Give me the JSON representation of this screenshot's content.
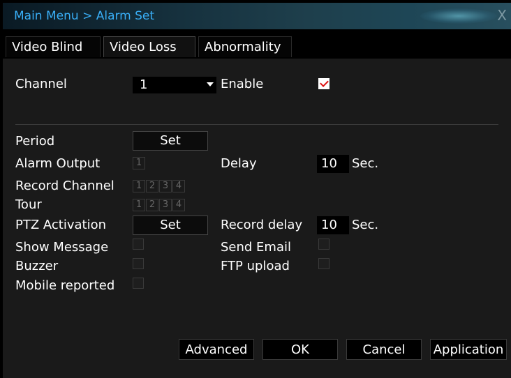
{
  "window": {
    "title": "Main Menu > Alarm Set",
    "close_label": "X"
  },
  "tabs": [
    {
      "label": "Video Blind"
    },
    {
      "label": "Video Loss"
    },
    {
      "label": "Abnormality"
    }
  ],
  "form": {
    "channel_label": "Channel",
    "channel_value": "1",
    "enable_label": "Enable",
    "enable_checked": true,
    "period_label": "Period",
    "period_button": "Set",
    "alarm_output_label": "Alarm Output",
    "alarm_output_boxes": [
      "1"
    ],
    "delay_label": "Delay",
    "delay_value": "10",
    "delay_unit": "Sec.",
    "record_channel_label": "Record Channel",
    "record_channel_boxes": [
      "1",
      "2",
      "3",
      "4"
    ],
    "tour_label": "Tour",
    "tour_boxes": [
      "1",
      "2",
      "3",
      "4"
    ],
    "ptz_label": "PTZ Activation",
    "ptz_button": "Set",
    "record_delay_label": "Record delay",
    "record_delay_value": "10",
    "record_delay_unit": "Sec.",
    "show_message_label": "Show Message",
    "send_email_label": "Send Email",
    "buzzer_label": "Buzzer",
    "ftp_upload_label": "FTP upload",
    "mobile_reported_label": "Mobile reported"
  },
  "footer": {
    "advanced": "Advanced",
    "ok": "OK",
    "cancel": "Cancel",
    "application": "Application"
  },
  "colors": {
    "title_text": "#39aef6",
    "panel_bg": "#1a1a1a",
    "check_mark": "#dd1111"
  }
}
